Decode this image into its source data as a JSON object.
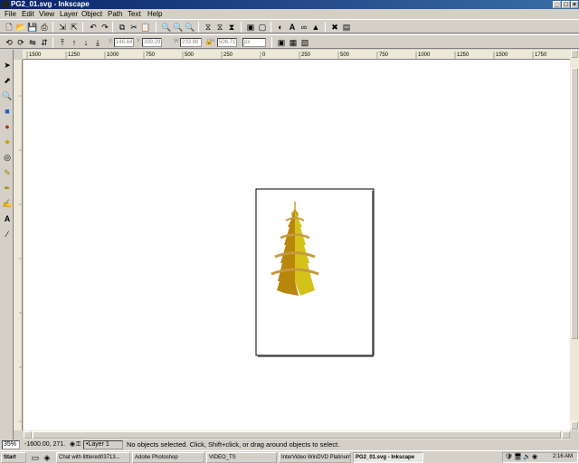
{
  "window": {
    "title": "PG2_01.svg - Inkscape"
  },
  "menu": [
    "File",
    "Edit",
    "View",
    "Layer",
    "Object",
    "Path",
    "Text",
    "Help"
  ],
  "toolbar2": {
    "x_label": "X",
    "x_value": "146.64",
    "y_label": "Y",
    "y_value": "399.29",
    "w_label": "W",
    "w_value": "233.86",
    "h_label": "H",
    "h_value": "506.71",
    "unit": "px"
  },
  "ruler_labels": [
    "1500",
    "1250",
    "1000",
    "750",
    "500",
    "250",
    "0",
    "250",
    "500",
    "750",
    "1000",
    "1250",
    "1500",
    "1750"
  ],
  "status": {
    "zoom": "35%",
    "coords": "-1600.00, 271.",
    "layer": "•Layer 1",
    "message": "No objects selected. Click, Shift+click, or drag around objects to select."
  },
  "taskbar": {
    "start": "Start",
    "tasks": [
      "Chat with littlered03713...",
      "Adobe Photoshop",
      "VIDEO_TS",
      "InterVideo WinDVD Platinum",
      "PG2_01.svg - Inkscape"
    ],
    "clock": "2:16 AM"
  },
  "colors": {
    "titlebar": "#0a246a",
    "pagoda_dark": "#b8860b",
    "pagoda_light": "#d4c21a",
    "eave": "#c79a3c"
  }
}
